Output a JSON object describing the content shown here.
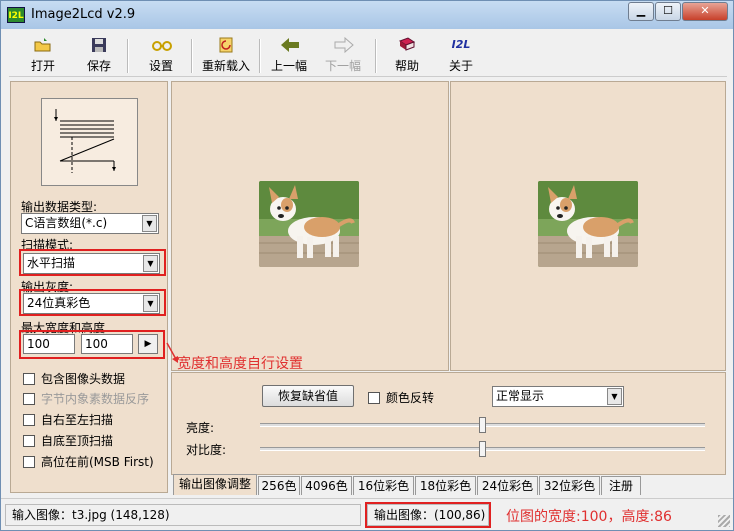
{
  "window": {
    "title": "Image2Lcd v2.9",
    "app_icon": "I2L",
    "controls": [
      "minimize-icon",
      "maximize-icon",
      "close-icon"
    ]
  },
  "toolbar": {
    "open": "打开",
    "save": "保存",
    "settings": "设置",
    "reload": "重新载入",
    "prev": "上一幅",
    "next": "下一幅",
    "help": "帮助",
    "about": "关于",
    "about_icon": "I2L"
  },
  "left": {
    "output_type_label": "输出数据类型:",
    "output_type_value": "C语言数组(*.c)",
    "scan_mode_label": "扫描模式:",
    "scan_mode_value": "水平扫描",
    "gray_label": "输出灰度:",
    "gray_value": "24位真彩色",
    "size_label": "最大宽度和高度",
    "max_width": "100",
    "max_height": "100",
    "checkboxes": [
      {
        "label": "包含图像头数据",
        "checked": false,
        "enabled": true
      },
      {
        "label": "字节内象素数据反序",
        "checked": false,
        "enabled": false
      },
      {
        "label": "自右至左扫描",
        "checked": false,
        "enabled": true
      },
      {
        "label": "自底至顶扫描",
        "checked": false,
        "enabled": true
      },
      {
        "label": "高位在前(MSB First)",
        "checked": false,
        "enabled": true
      }
    ]
  },
  "annotations": {
    "size_note": "宽度和高度自行设置",
    "output_note": "位图的宽度:100，高度:86",
    "highlight_color": "#e02020"
  },
  "settings": {
    "restore_default": "恢复缺省值",
    "invert_colors": "颜色反转",
    "display_mode": "正常显示",
    "brightness_label": "亮度:",
    "contrast_label": "对比度:",
    "brightness_level": 0.5,
    "contrast_level": 0.5
  },
  "tabs": [
    "输出图像调整",
    "256色",
    "4096色",
    "16位彩色",
    "18位彩色",
    "24位彩色",
    "32位彩色",
    "注册"
  ],
  "status": {
    "input_image": "输入图像：t3.jpg (148,128)",
    "output_image": "输出图像：(100,86)"
  }
}
